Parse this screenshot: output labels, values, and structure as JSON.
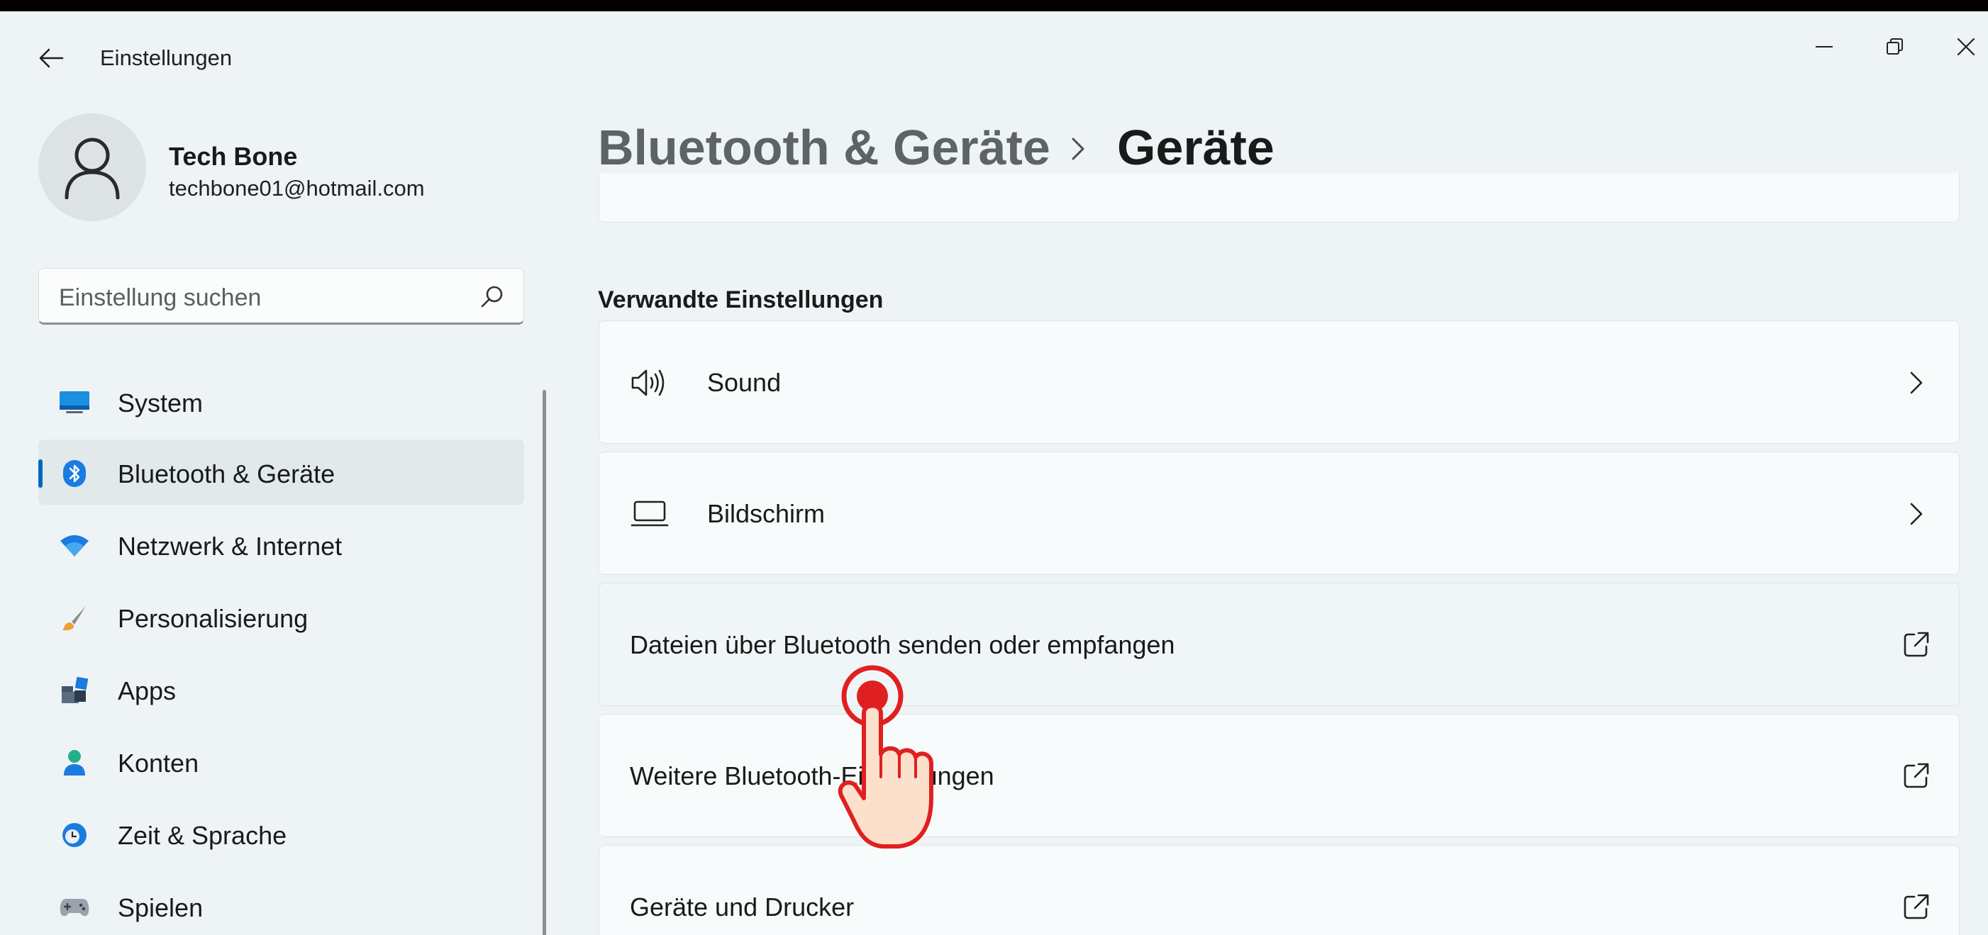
{
  "window": {
    "title": "Einstellungen"
  },
  "profile": {
    "name": "Tech Bone",
    "email": "techbone01@hotmail.com"
  },
  "search": {
    "placeholder": "Einstellung suchen"
  },
  "sidebar": {
    "items": [
      {
        "label": "System",
        "icon": "system-monitor-icon",
        "active": false
      },
      {
        "label": "Bluetooth & Geräte",
        "icon": "bluetooth-icon",
        "active": true
      },
      {
        "label": "Netzwerk & Internet",
        "icon": "wifi-icon",
        "active": false
      },
      {
        "label": "Personalisierung",
        "icon": "paintbrush-icon",
        "active": false
      },
      {
        "label": "Apps",
        "icon": "apps-icon",
        "active": false
      },
      {
        "label": "Konten",
        "icon": "user-icon",
        "active": false
      },
      {
        "label": "Zeit & Sprache",
        "icon": "globe-clock-icon",
        "active": false
      },
      {
        "label": "Spielen",
        "icon": "gamepad-icon",
        "active": false
      }
    ]
  },
  "breadcrumb": {
    "parent": "Bluetooth & Geräte",
    "current": "Geräte"
  },
  "related": {
    "title": "Verwandte Einstellungen",
    "cards": [
      {
        "label": "Sound",
        "icon": "speaker-icon",
        "action": "chevron-right-icon"
      },
      {
        "label": "Bildschirm",
        "icon": "laptop-icon",
        "action": "chevron-right-icon"
      },
      {
        "label": "Dateien über Bluetooth senden oder empfangen",
        "icon": "",
        "action": "external-link-icon"
      },
      {
        "label": "Weitere Bluetooth-Einstellungen",
        "icon": "",
        "action": "external-link-icon"
      },
      {
        "label": "Geräte und Drucker",
        "icon": "",
        "action": "external-link-icon"
      }
    ]
  },
  "colors": {
    "accent": "#0067c0",
    "background": "#eef4f6",
    "card": "#f7fbfb",
    "pointer": "#e02020"
  }
}
